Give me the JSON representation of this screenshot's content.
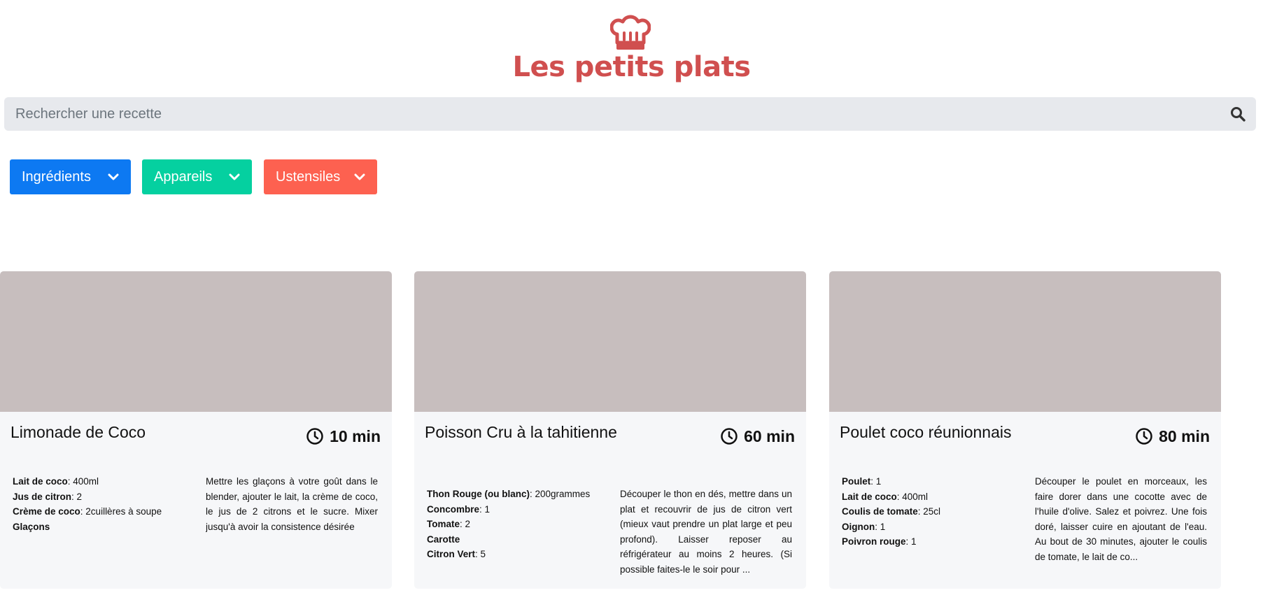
{
  "header": {
    "logo_icon": "chef-hat-icon",
    "title": "Les petits plats",
    "accent_color": "#d04f4f"
  },
  "search": {
    "placeholder": "Rechercher une recette",
    "value": "",
    "icon": "search-icon"
  },
  "filters": [
    {
      "label": "Ingrédients",
      "color": "#0d79f2",
      "icon": "chevron-down-icon"
    },
    {
      "label": "Appareils",
      "color": "#05d0a0",
      "icon": "chevron-down-icon"
    },
    {
      "label": "Ustensiles",
      "color": "#fd6150",
      "icon": "chevron-down-icon"
    }
  ],
  "recipes": [
    {
      "title": "Limonade de Coco",
      "time": "10 min",
      "ingredients": [
        {
          "name": "Lait de coco",
          "qty": ": 400ml"
        },
        {
          "name": "Jus de citron",
          "qty": ": 2"
        },
        {
          "name": "Crème de coco",
          "qty": ": 2cuillères à soupe"
        },
        {
          "name": "Glaçons",
          "qty": ""
        }
      ],
      "description": "Mettre les glaçons à votre goût dans le blender, ajouter le lait, la crème de coco, le jus de 2 citrons et le sucre. Mixer jusqu'à avoir la consistence désirée"
    },
    {
      "title": "Poisson Cru à la tahitienne",
      "time": "60 min",
      "ingredients": [
        {
          "name": "Thon Rouge (ou blanc)",
          "qty": ": 200grammes"
        },
        {
          "name": "Concombre",
          "qty": ": 1"
        },
        {
          "name": "Tomate",
          "qty": ": 2"
        },
        {
          "name": "Carotte",
          "qty": ""
        },
        {
          "name": "Citron Vert",
          "qty": ": 5"
        }
      ],
      "description": "Découper le thon en dés, mettre dans un plat et recouvrir de jus de citron vert (mieux vaut prendre un plat large et peu profond). Laisser reposer au réfrigérateur au moins 2 heures. (Si possible faites-le le soir pour ..."
    },
    {
      "title": "Poulet coco réunionnais",
      "time": "80 min",
      "ingredients": [
        {
          "name": "Poulet",
          "qty": ": 1"
        },
        {
          "name": "Lait de coco",
          "qty": ": 400ml"
        },
        {
          "name": "Coulis de tomate",
          "qty": ": 25cl"
        },
        {
          "name": "Oignon",
          "qty": ": 1"
        },
        {
          "name": "Poivron rouge",
          "qty": ": 1"
        }
      ],
      "description": "Découper le poulet en morceaux, les faire dorer dans une cocotte avec de l'huile d'olive. Salez et poivrez. Une fois doré, laisser cuire en ajoutant de l'eau. Au bout de 30 minutes, ajouter le coulis de tomate, le lait de co..."
    }
  ],
  "icons": {
    "time": "clock-icon"
  }
}
